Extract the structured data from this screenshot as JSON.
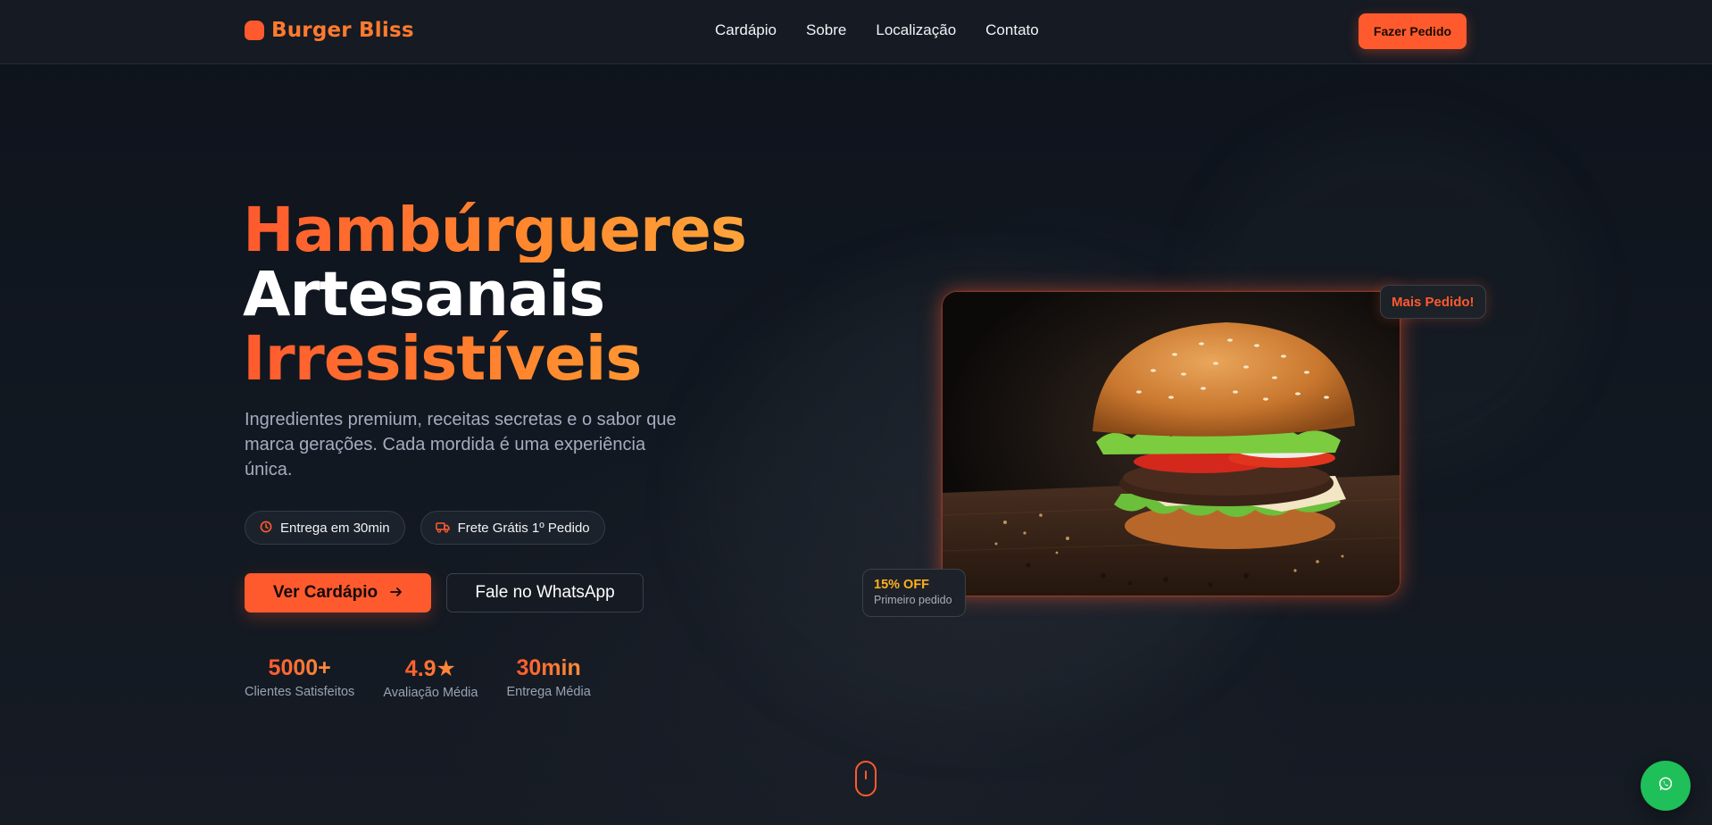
{
  "nav": {
    "brand": "Burger Bliss",
    "links": [
      "Cardápio",
      "Sobre",
      "Localização",
      "Contato"
    ],
    "order_button": "Fazer Pedido"
  },
  "hero": {
    "title_line1": "Hambúrgueres",
    "title_line2": "Artesanais",
    "title_line3": "Irresistíveis",
    "subtitle": "Ingredientes premium, receitas secretas e o sabor que marca gerações. Cada mordida é uma experiência única.",
    "chips": [
      {
        "icon": "clock-icon",
        "label": "Entrega em 30min"
      },
      {
        "icon": "truck-icon",
        "label": "Frete Grátis 1º Pedido"
      }
    ],
    "primary_button": "Ver Cardápio",
    "secondary_button": "Fale no WhatsApp",
    "stats": [
      {
        "value": "5000+",
        "label": "Clientes Satisfeitos"
      },
      {
        "value": "4.9★",
        "label": "Avaliação Média"
      },
      {
        "value": "30min",
        "label": "Entrega Média"
      }
    ]
  },
  "product": {
    "badge": "Mais Pedido!",
    "discount_title": "15% OFF",
    "discount_subtitle": "Primeiro pedido"
  },
  "colors": {
    "accent": "#ff5a2e",
    "accent_light": "#ff8a2e",
    "background": "#0f141d",
    "whatsapp": "#1fbf5a"
  }
}
